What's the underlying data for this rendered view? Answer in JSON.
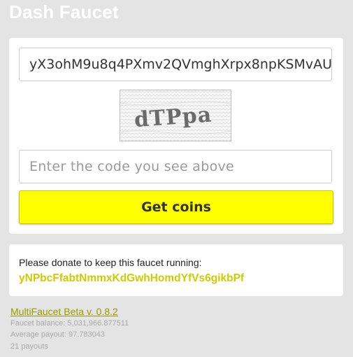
{
  "header": {
    "title": "Dash Faucet"
  },
  "form": {
    "address_value": "yX3ohM9u8q4PXmv2QVmghXrpx8npKSMvAU",
    "captcha_text": "dTPpa",
    "code_placeholder": "Enter the code you see above",
    "submit_label": "Get coins"
  },
  "donate": {
    "message": "Please donate to keep this faucet running:",
    "address": "yNPbcFfabtNmmxKdGwhHomdYfVs6gikbPf"
  },
  "footer": {
    "link_label": "MultiFaucet Beta v. 0.8.2",
    "balance": "Faucet balance: 5,031,966.877511",
    "average": "Average payout: 97.783043",
    "payouts": "21 payouts"
  },
  "colors": {
    "accent_yellow": "#ffff00",
    "link_olive": "#999900",
    "donate_address": "#cccc00",
    "page_bg": "#e4e4e4"
  }
}
